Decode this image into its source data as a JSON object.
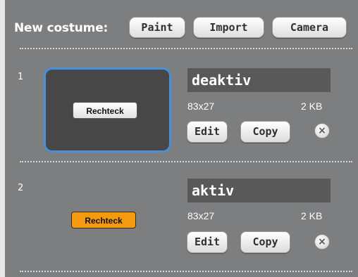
{
  "header": {
    "label": "New costume:",
    "buttons": [
      "Paint",
      "Import",
      "Camera"
    ]
  },
  "costumes": [
    {
      "number": "1",
      "name": "deaktiv",
      "thumbnail_text": "Rechteck",
      "dimensions": "83x27",
      "size": "2 KB",
      "edit_label": "Edit",
      "copy_label": "Copy",
      "selected": true
    },
    {
      "number": "2",
      "name": "aktiv",
      "thumbnail_text": "Rechteck",
      "dimensions": "83x27",
      "size": "2 KB",
      "edit_label": "Edit",
      "copy_label": "Copy",
      "selected": false
    }
  ],
  "colors": {
    "panel_bg": "#7c7e80",
    "selection_border": "#4a8fd8",
    "thumbnail_orange": "#f39a10"
  },
  "icons": {
    "delete": "close-circle-icon"
  }
}
